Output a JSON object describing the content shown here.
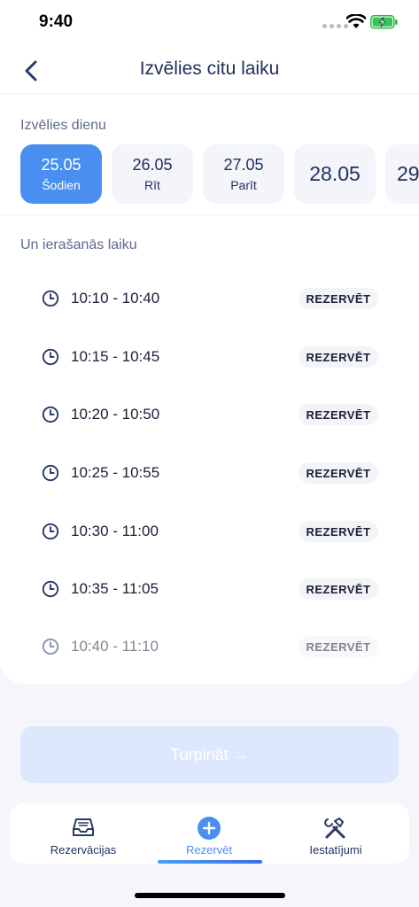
{
  "status_bar": {
    "time": "9:40"
  },
  "header": {
    "title": "Izvēlies citu laiku"
  },
  "days_section": {
    "label": "Izvēlies dienu",
    "days": [
      {
        "date": "25.05",
        "sub": "Šodien",
        "selected": true
      },
      {
        "date": "26.05",
        "sub": "Rīt",
        "selected": false
      },
      {
        "date": "27.05",
        "sub": "Parīt",
        "selected": false
      },
      {
        "date": "28.05",
        "sub": "",
        "selected": false
      },
      {
        "date": "29",
        "sub": "",
        "selected": false
      }
    ]
  },
  "slots_section": {
    "label": "Un ierašanās laiku",
    "reserve_label": "REZERVĒT",
    "slots": [
      {
        "time": "10:10 - 10:40"
      },
      {
        "time": "10:15 - 10:45"
      },
      {
        "time": "10:20 - 10:50"
      },
      {
        "time": "10:25 - 10:55"
      },
      {
        "time": "10:30 - 11:00"
      },
      {
        "time": "10:35 - 11:05"
      },
      {
        "time": "10:40 - 11:10"
      }
    ]
  },
  "continue_button": {
    "label": "Turpināt →"
  },
  "tab_bar": {
    "tabs": [
      {
        "label": "Rezervācijas",
        "icon": "inbox-tray-icon",
        "active": false
      },
      {
        "label": "Rezervēt",
        "icon": "plus-circle-icon",
        "active": true
      },
      {
        "label": "Iestatījumi",
        "icon": "tools-icon",
        "active": false
      }
    ]
  },
  "colors": {
    "accent": "#4a8ff0",
    "text": "#1e2f5c",
    "continue_disabled": "#dde8fc"
  }
}
